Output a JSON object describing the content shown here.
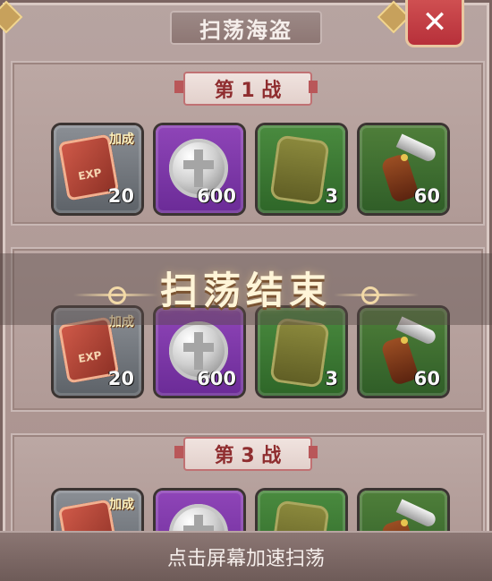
{
  "header": {
    "title": "扫荡海盗",
    "close_icon": "close-icon"
  },
  "battles": [
    {
      "label": "第 1 战",
      "items": [
        {
          "count": "20",
          "boost": "加成"
        },
        {
          "count": "600"
        },
        {
          "count": "3"
        },
        {
          "count": "60"
        }
      ]
    },
    {
      "items": [
        {
          "count": "20",
          "boost": "加成"
        },
        {
          "count": "600"
        },
        {
          "count": "3"
        },
        {
          "count": "60"
        }
      ]
    },
    {
      "label": "第 3 战",
      "items": [
        {
          "boost": "加成"
        }
      ]
    }
  ],
  "overlay": {
    "title": "扫荡结束"
  },
  "footer": {
    "hint": "点击屏幕加速扫荡"
  }
}
